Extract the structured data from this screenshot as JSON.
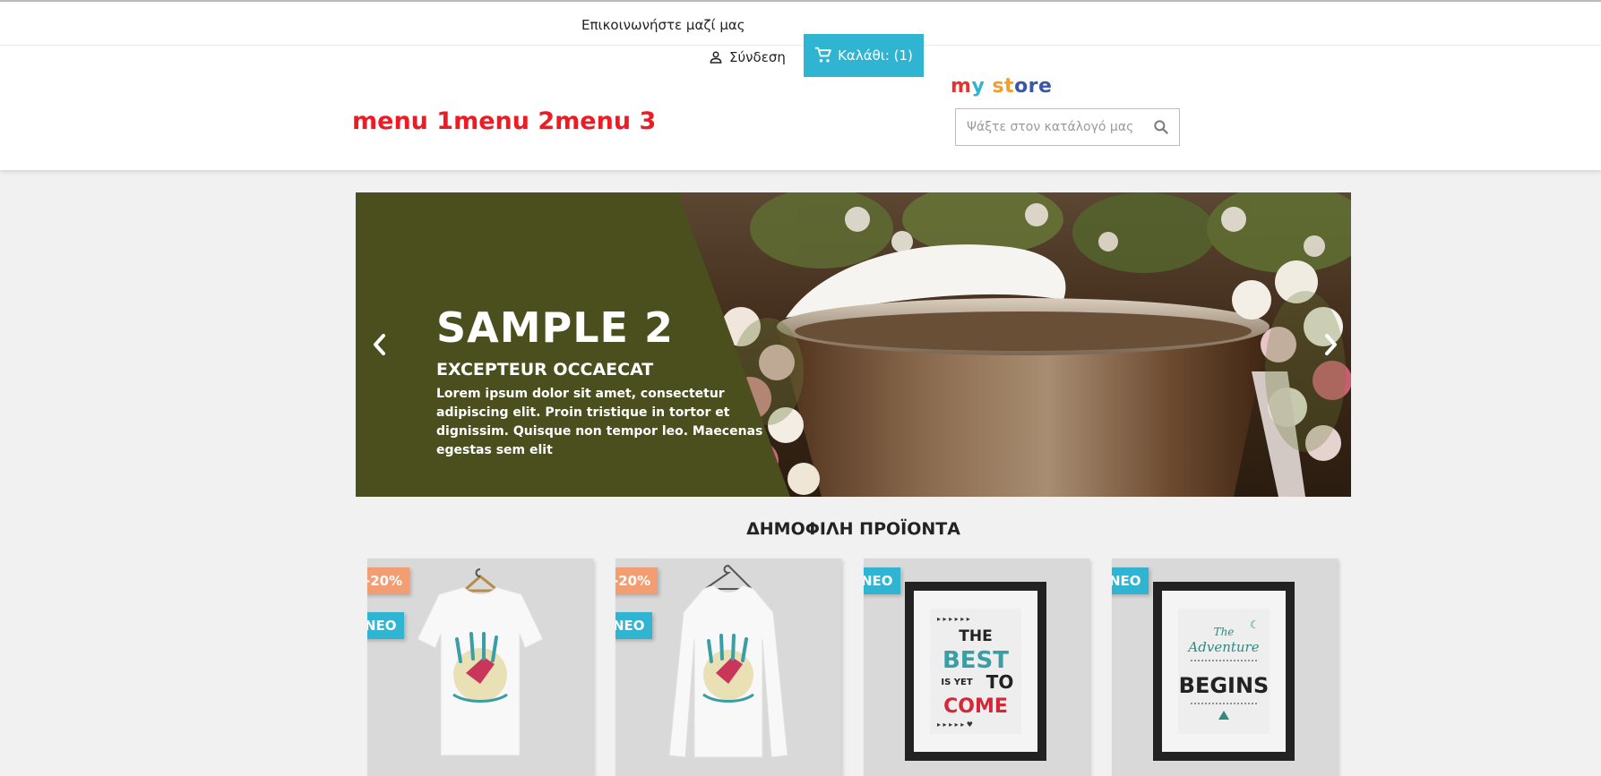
{
  "header": {
    "contact_link": "Επικοινωνήστε μαζί μας",
    "signin_label": "Σύνδεση",
    "cart_label": "Καλάθι: (1)",
    "logo": {
      "part1": "m",
      "part2": "y ",
      "part3": "st",
      "part4": "ore"
    },
    "menu": [
      "menu 1",
      "menu 2",
      "menu 3"
    ],
    "search_placeholder": "Ψάξτε στον κατάλογό μας",
    "colors": {
      "accent": "#2fb5d2",
      "menu": "#ed1c24"
    }
  },
  "slider": {
    "title": "SAMPLE 2",
    "subtitle": "EXCEPTEUR OCCAECAT",
    "text": "Lorem ipsum dolor sit amet, consectetur adipiscing elit. Proin tristique in tortor et dignissim. Quisque non tempor leo. Maecenas egestas sem elit",
    "panel_color": "#4a4f1d",
    "prev_icon": "chevron-left-icon",
    "next_icon": "chevron-right-icon"
  },
  "popular": {
    "title": "ΔΗΜΟΦΙΛΗ ΠΡΟΪΟΝΤΑ",
    "products": [
      {
        "discount": "-20%",
        "badge": "ΝΕΟ",
        "image": "hummingbird t-shirt"
      },
      {
        "discount": "-20%",
        "badge": "ΝΕΟ",
        "image": "hummingbird sweater"
      },
      {
        "badge": "ΝΕΟ",
        "image": "framed poster",
        "poster_line1": "THE",
        "poster_line2": "BEST",
        "poster_line3": "IS YET",
        "poster_line4": "TO",
        "poster_line5": "COME"
      },
      {
        "badge": "ΝΕΟ",
        "image": "framed poster",
        "poster_line1": "The",
        "poster_line2": "Adventure",
        "poster_line3": "BEGINS"
      }
    ]
  }
}
